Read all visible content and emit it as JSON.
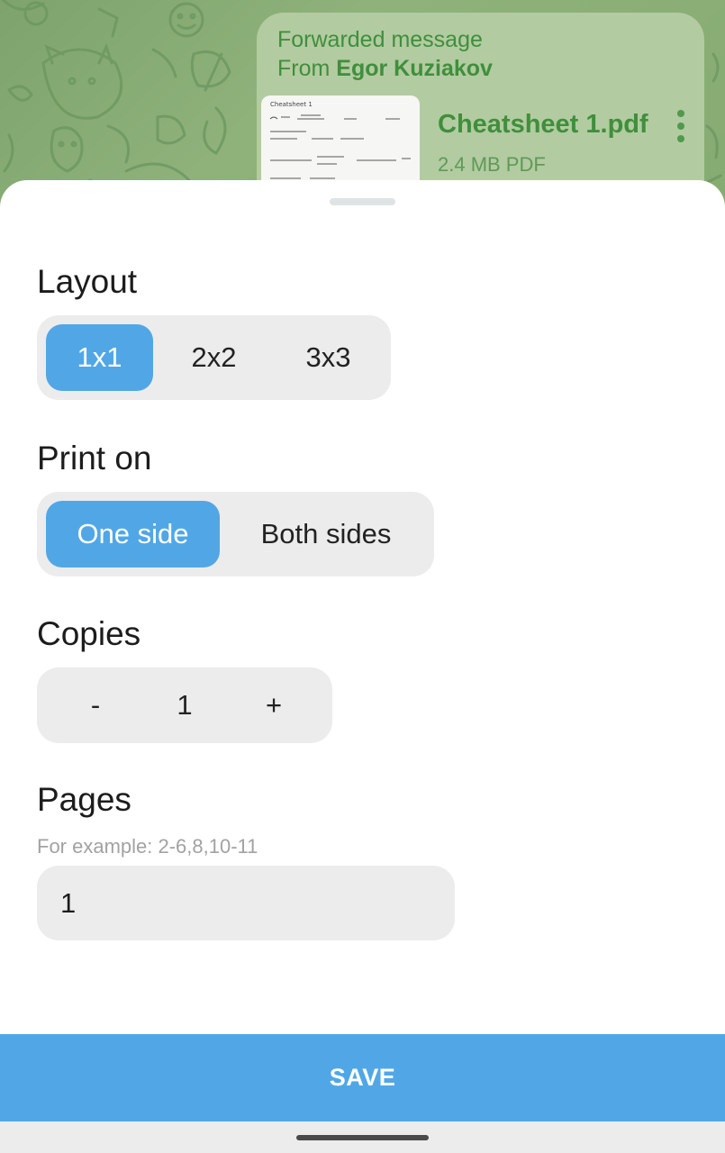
{
  "chat": {
    "forwarded_label": "Forwarded message",
    "from_prefix": "From",
    "sender": "Egor Kuziakov",
    "file": {
      "name": "Cheatsheet 1.pdf",
      "meta": "2.4 MB PDF",
      "thumbnail_title": "Cheatsheet 1"
    },
    "menu_icon": "more-vertical-icon"
  },
  "sheet": {
    "layout": {
      "title": "Layout",
      "options": [
        "1x1",
        "2x2",
        "3x3"
      ],
      "selected": "1x1"
    },
    "print_on": {
      "title": "Print on",
      "options": [
        "One side",
        "Both sides"
      ],
      "selected": "One side"
    },
    "copies": {
      "title": "Copies",
      "decrement": "-",
      "value": "1",
      "increment": "+"
    },
    "pages": {
      "title": "Pages",
      "hint": "For example: 2-6,8,10-11",
      "value": "1"
    },
    "save_label": "SAVE"
  },
  "colors": {
    "accent": "#51a7e6",
    "chat_text": "#3f8f3c",
    "bubble": "#b3cba1",
    "segment_bg": "#ececec"
  }
}
